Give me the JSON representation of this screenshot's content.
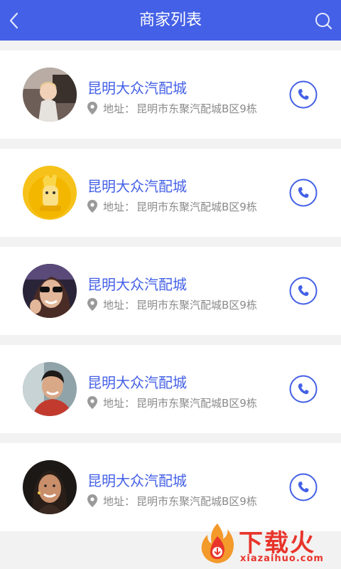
{
  "header": {
    "title": "商家列表",
    "back_icon": "chevron-left-icon",
    "search_icon": "search-icon"
  },
  "colors": {
    "accent": "#4460e6",
    "background": "#f2f2f2",
    "card": "#ffffff",
    "address_text": "#8a8a8a"
  },
  "merchants": [
    {
      "name": "昆明大众汽配城",
      "address_prefix": "地址：",
      "address": "昆明市东聚汽配城B区9栋",
      "avatar": "child-in-car-photo",
      "call_icon": "phone-icon"
    },
    {
      "name": "昆明大众汽配城",
      "address_prefix": "地址：",
      "address": "昆明市东聚汽配城B区9栋",
      "avatar": "yellow-toy-figure-photo",
      "call_icon": "phone-icon"
    },
    {
      "name": "昆明大众汽配城",
      "address_prefix": "地址：",
      "address": "昆明市东聚汽配城B区9栋",
      "avatar": "woman-sunglasses-photo",
      "call_icon": "phone-icon"
    },
    {
      "name": "昆明大众汽配城",
      "address_prefix": "地址：",
      "address": "昆明市东聚汽配城B区9栋",
      "avatar": "man-in-car-photo",
      "call_icon": "phone-icon"
    },
    {
      "name": "昆明大众汽配城",
      "address_prefix": "地址：",
      "address": "昆明市东聚汽配城B区9栋",
      "avatar": "smiling-woman-photo",
      "call_icon": "phone-icon"
    }
  ],
  "watermark": {
    "text": "下载火",
    "url": "xiazaihuo.com",
    "logo": "flame-logo"
  }
}
